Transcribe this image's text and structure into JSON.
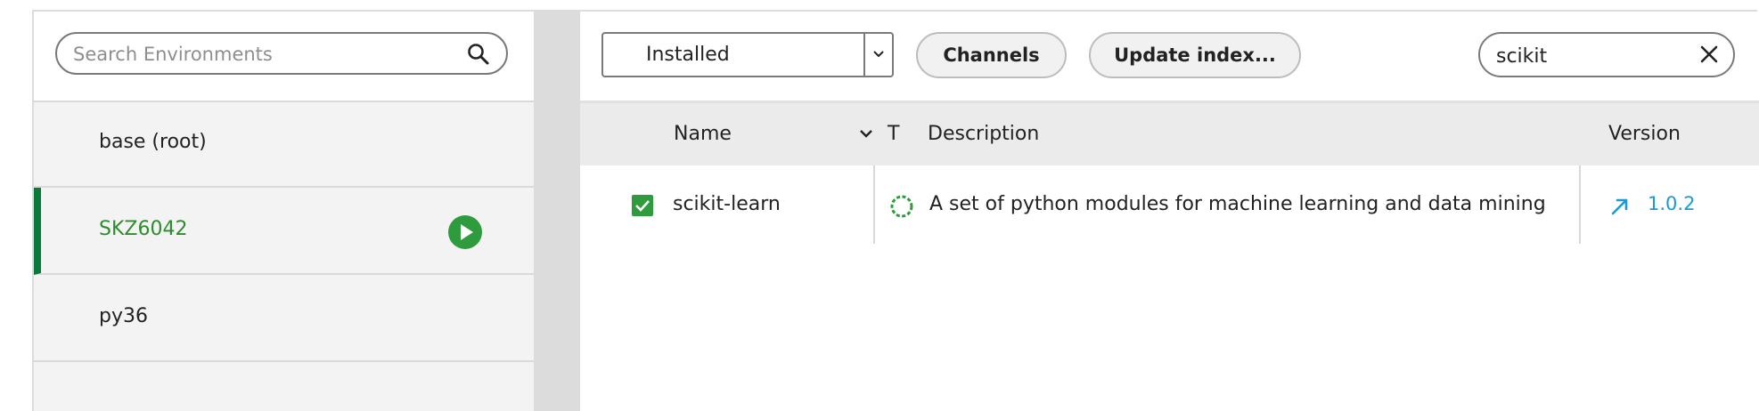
{
  "environments": {
    "search_placeholder": "Search Environments",
    "search_value": "",
    "items": [
      {
        "label": "base (root)",
        "active": false
      },
      {
        "label": "SKZ6042",
        "active": true
      },
      {
        "label": "py36",
        "active": false
      }
    ]
  },
  "packages": {
    "filter_selected": "Installed",
    "channels_label": "Channels",
    "update_index_label": "Update index...",
    "search_value": "scikit",
    "columns": {
      "name": "Name",
      "type": "T",
      "description": "Description",
      "version": "Version"
    },
    "rows": [
      {
        "checked": true,
        "name": "scikit-learn",
        "description": "A set of python modules for machine learning and data mining",
        "version": "1.0.2",
        "update_available": true
      }
    ]
  },
  "colors": {
    "accent_green": "#2e9b3c",
    "active_bar": "#0a7a3a",
    "version_blue": "#1a9ad6"
  },
  "icons": {
    "env_search": "search-icon",
    "env_run": "play-circle-icon",
    "filter_dropdown": "chevron-down-icon",
    "pkg_search_clear": "close-icon",
    "name_sort": "chevron-down-icon",
    "pkg_status": "installed-circle-icon",
    "pkg_update": "arrow-up-right-icon",
    "pkg_checkbox": "checkbox-checked-icon"
  }
}
